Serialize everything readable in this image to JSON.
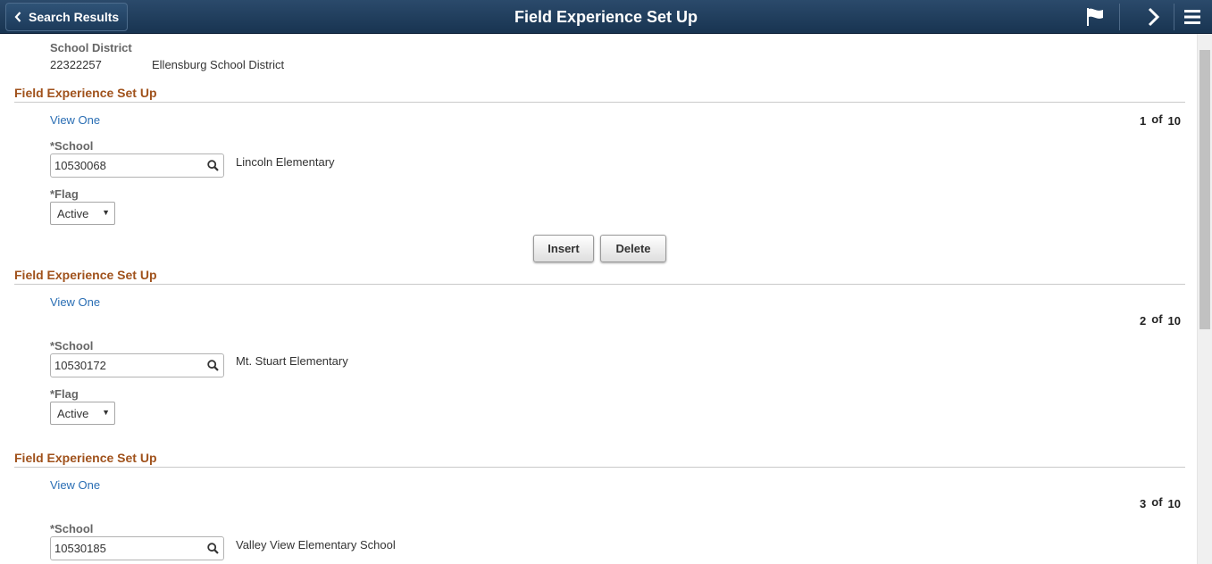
{
  "header": {
    "back_label": "Search Results",
    "title": "Field Experience Set Up"
  },
  "district": {
    "label": "School District",
    "id": "22322257",
    "name": "Ellensburg School District"
  },
  "common": {
    "view_one": "View One",
    "of": "of",
    "school_label": "*School",
    "flag_label": "*Flag"
  },
  "rows": [
    {
      "section_title": "Field Experience Set Up",
      "index": "1",
      "total": "10",
      "school_id": "10530068",
      "school_name": "Lincoln Elementary",
      "flag": "Active"
    },
    {
      "section_title": "Field Experience Set Up",
      "index": "2",
      "total": "10",
      "school_id": "10530172",
      "school_name": "Mt. Stuart Elementary",
      "flag": "Active"
    },
    {
      "section_title": "Field Experience Set Up",
      "index": "3",
      "total": "10",
      "school_id": "10530185",
      "school_name": "Valley View Elementary School"
    }
  ],
  "buttons": {
    "insert": "Insert",
    "delete": "Delete"
  },
  "icons": {
    "back": "chevron-left-icon",
    "flag": "flag-icon",
    "next": "chevron-right-icon",
    "menu": "hamburger-menu-icon",
    "lookup": "search-icon"
  },
  "colors": {
    "header_bg": "#1f3c5c",
    "section_title": "#a0521c",
    "link": "#2a6eb4"
  }
}
